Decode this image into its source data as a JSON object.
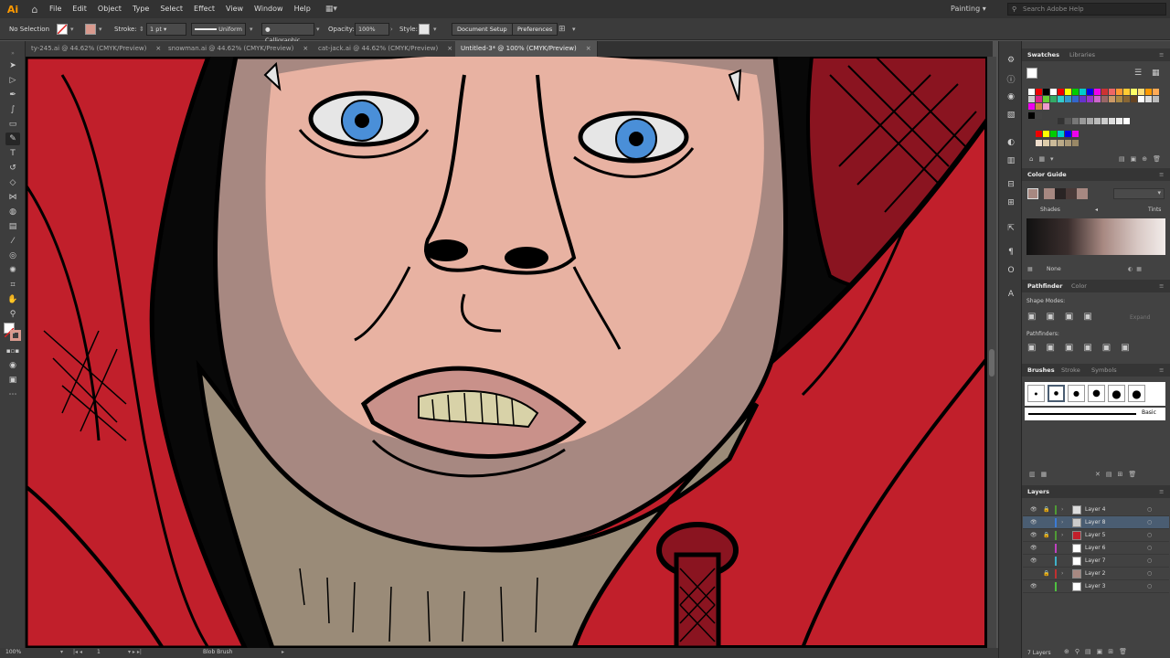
{
  "app": {
    "logo": "Ai"
  },
  "menu": [
    "File",
    "Edit",
    "Object",
    "Type",
    "Select",
    "Effect",
    "View",
    "Window",
    "Help"
  ],
  "workspace": "Painting",
  "stock_search_placeholder": "Search Adobe Help",
  "control": {
    "selection": "No Selection",
    "stroke_label": "Stroke:",
    "stroke_weight": "1 pt",
    "profile": "Uniform",
    "brush": "Calligraphic...",
    "opacity_label": "Opacity:",
    "opacity": "100%",
    "style_label": "Style:",
    "doc_setup": "Document Setup",
    "preferences": "Preferences"
  },
  "tabs": [
    {
      "label": "ty-245.ai @ 44.62% (CMYK/Preview)",
      "active": false
    },
    {
      "label": "snowman.ai @ 44.62% (CMYK/Preview)",
      "active": false
    },
    {
      "label": "cat-jack.ai @ 44.62% (CMYK/Preview)",
      "active": false
    },
    {
      "label": "Untitled-3* @ 100% (CMYK/Preview)",
      "active": true
    }
  ],
  "status": {
    "zoom": "100%",
    "artboard": "1",
    "tool": "Blob Brush"
  },
  "panels": {
    "swatches_tab": "Swatches",
    "libraries_tab": "Libraries",
    "color_guide_tab": "Color Guide",
    "shades": "Shades",
    "tints": "Tints",
    "none": "None",
    "pathfinder_tab": "Pathfinder",
    "color_tab": "Color",
    "shape_modes": "Shape Modes:",
    "expand": "Expand",
    "pathfinders": "Pathfinders:",
    "brushes_tab": "Brushes",
    "stroke_tab": "Stroke",
    "symbols_tab": "Symbols",
    "basic": "Basic",
    "layers_tab": "Layers",
    "layers_count": "7 Layers"
  },
  "layers": [
    {
      "name": "Layer 4",
      "color": "#4f9a35",
      "locked": true,
      "selected": false
    },
    {
      "name": "Layer 8",
      "color": "#3b7bd6",
      "locked": false,
      "selected": true
    },
    {
      "name": "Layer 5",
      "color": "#4f9a35",
      "locked": true,
      "selected": false
    },
    {
      "name": "Layer 6",
      "color": "#c040c0",
      "locked": false,
      "selected": false
    },
    {
      "name": "Layer 7",
      "color": "#3fb0c8",
      "locked": false,
      "selected": false
    },
    {
      "name": "Layer 2",
      "color": "#c03030",
      "locked": true,
      "selected": false
    },
    {
      "name": "Layer 3",
      "color": "#4fc040",
      "locked": false,
      "selected": false
    }
  ],
  "colors": {
    "red": "#c11f2b",
    "dark_red": "#8a1420",
    "skin": "#e8b2a2",
    "skin_shadow": "#a78881",
    "beard": "#9a8b78",
    "teeth": "#d8d2a8",
    "iris": "#4a8fd8"
  }
}
